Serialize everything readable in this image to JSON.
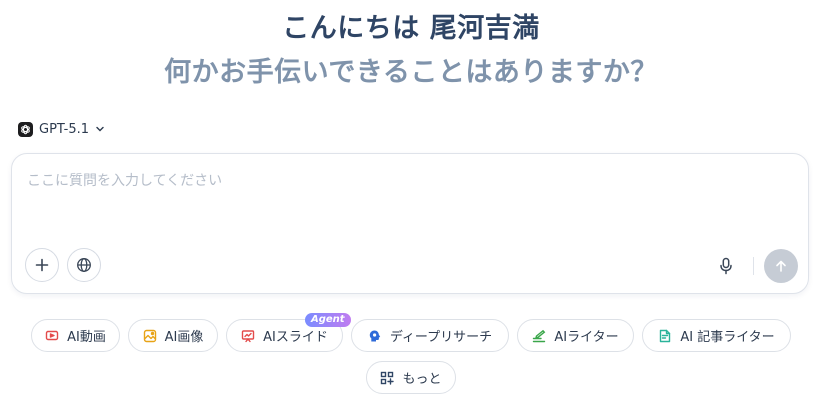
{
  "header": {
    "greeting": "こんにちは 尾河吉満",
    "subtitle": "何かお手伝いできることはありますか？"
  },
  "model_selector": {
    "label": "GPT-5.1",
    "icon": "openai-logo-icon"
  },
  "composer": {
    "placeholder": "ここに質問を入力してください",
    "value": ""
  },
  "tools": [
    {
      "label": "AI動画",
      "icon": "video-icon",
      "color": "#e34b4b"
    },
    {
      "label": "AI画像",
      "icon": "image-icon",
      "color": "#e8a317"
    },
    {
      "label": "AIスライド",
      "icon": "slides-icon",
      "color": "#e34b4b",
      "badge": "Agent"
    },
    {
      "label": "ディープリサーチ",
      "icon": "research-icon",
      "color": "#2f6bd9"
    },
    {
      "label": "AIライター",
      "icon": "writer-icon",
      "color": "#3aa64a"
    },
    {
      "label": "AI 記事ライター",
      "icon": "article-icon",
      "color": "#2bb39a"
    },
    {
      "label": "もっと",
      "icon": "more-grid-icon",
      "color": "#2f4565"
    }
  ]
}
